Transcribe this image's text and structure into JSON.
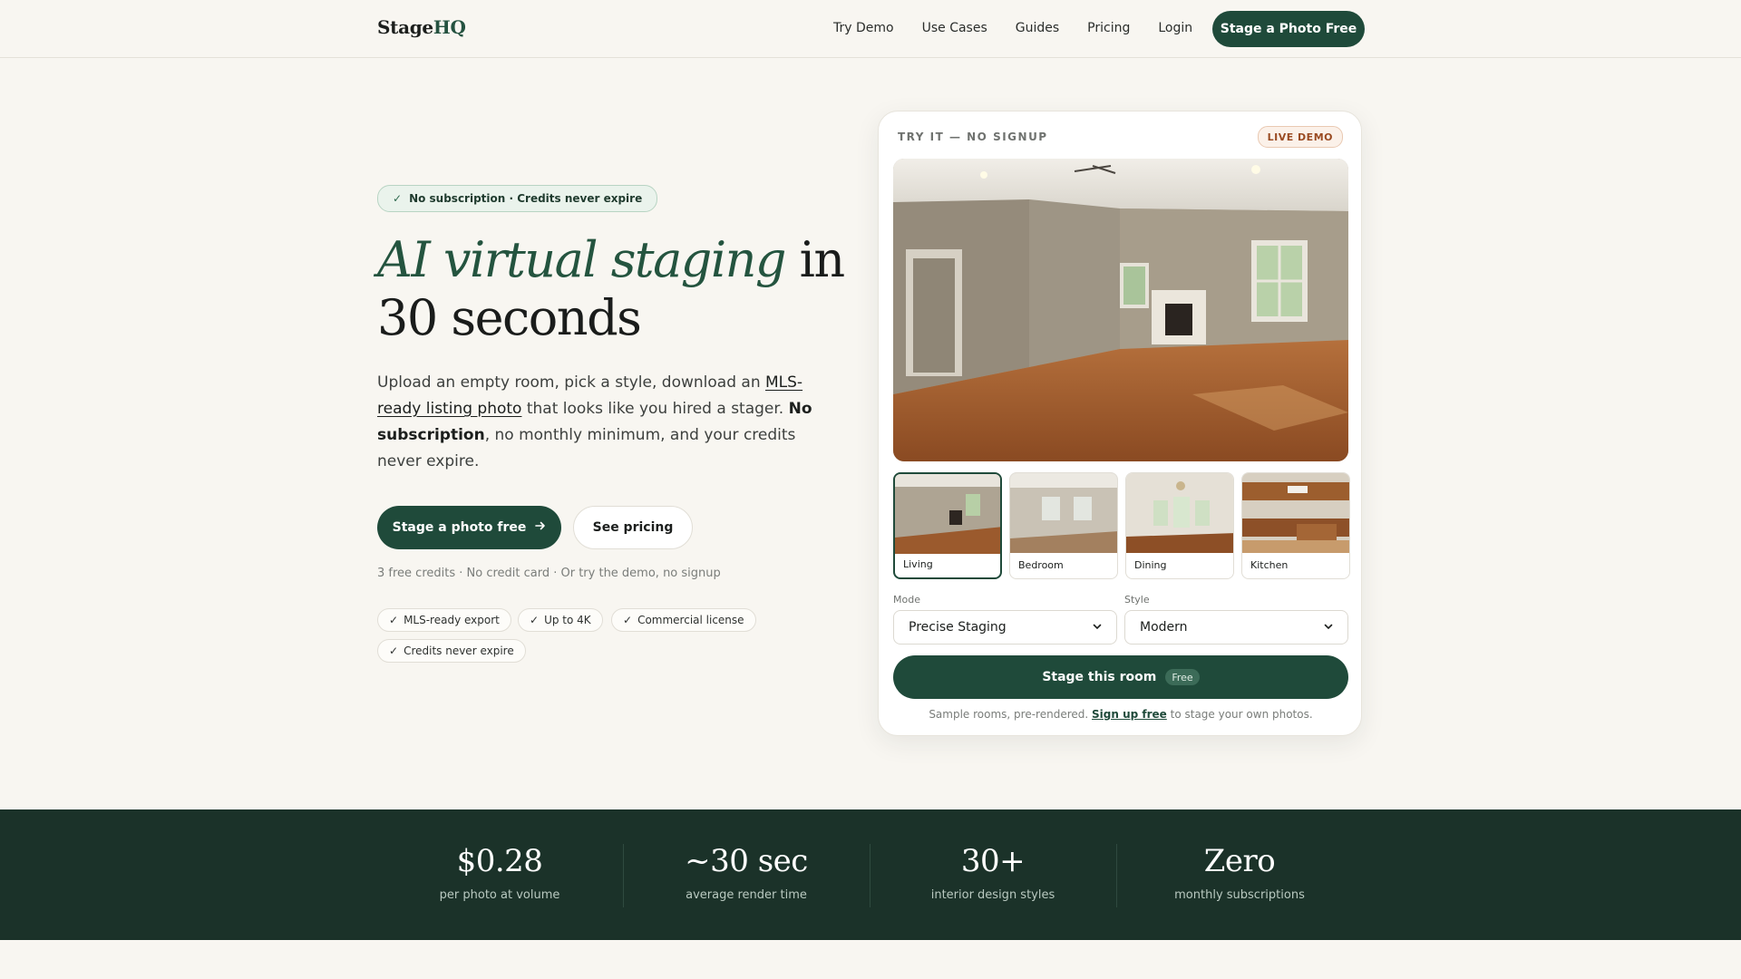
{
  "brand": {
    "name_part1": "Stage",
    "name_part2": "HQ"
  },
  "nav": {
    "links": [
      "Try Demo",
      "Use Cases",
      "Guides",
      "Pricing",
      "Login"
    ],
    "cta": "Stage a Photo Free"
  },
  "hero": {
    "badge": "No subscription · Credits never expire",
    "headline_accent": "AI virtual staging",
    "headline_rest_1": "in",
    "headline_rest_2": "30 seconds",
    "lead": {
      "p1": "Upload an empty room, pick a style, download an ",
      "link": "MLS-ready listing photo",
      "p2": " that looks like you hired a stager. ",
      "bold": "No subscription",
      "p3": ", no monthly minimum, and your credits never expire."
    },
    "primary_button": "Stage a photo free",
    "secondary_button": "See pricing",
    "fine_print": "3 free credits · No credit card · Or try the demo, no signup",
    "features": [
      "MLS-ready export",
      "Up to 4K",
      "Commercial license",
      "Credits never expire"
    ]
  },
  "demo": {
    "eyebrow": "TRY IT — NO SIGNUP",
    "badge": "LIVE DEMO",
    "rooms": [
      {
        "label": "Living",
        "selected": true
      },
      {
        "label": "Bedroom",
        "selected": false
      },
      {
        "label": "Dining",
        "selected": false
      },
      {
        "label": "Kitchen",
        "selected": false
      }
    ],
    "mode_label": "Mode",
    "mode_value": "Precise Staging",
    "style_label": "Style",
    "style_value": "Modern",
    "stage_button": "Stage this room",
    "stage_tag": "Free",
    "note_p1": "Sample rooms, pre-rendered. ",
    "note_link": "Sign up free",
    "note_p2": " to stage your own photos."
  },
  "stats": [
    {
      "value": "$0.28",
      "label": "per photo at volume"
    },
    {
      "value": "~30 sec",
      "label": "average render time"
    },
    {
      "value": "30+",
      "label": "interior design styles"
    },
    {
      "value": "Zero",
      "label": "monthly subscriptions"
    }
  ],
  "colors": {
    "brand_green": "#1f4a3a",
    "accent_green": "#24543f",
    "stats_bg": "#1b3229",
    "page_bg": "#f8f6f1"
  }
}
